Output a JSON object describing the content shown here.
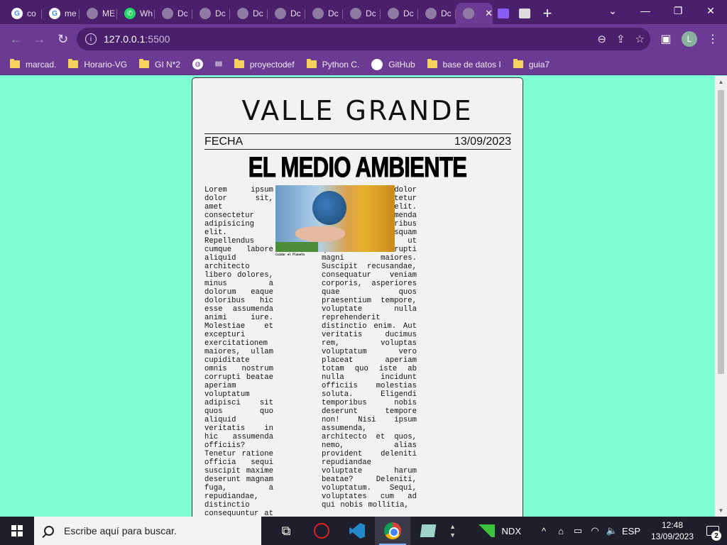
{
  "browser": {
    "tabs": [
      {
        "title": "co",
        "icon": "google-icon"
      },
      {
        "title": "me",
        "icon": "google-icon"
      },
      {
        "title": "ME",
        "icon": "globe-icon"
      },
      {
        "title": "Wh",
        "icon": "whatsapp-icon"
      },
      {
        "title": "Dc",
        "icon": "globe-icon"
      },
      {
        "title": "Dc",
        "icon": "globe-icon"
      },
      {
        "title": "Dc",
        "icon": "globe-icon"
      },
      {
        "title": "Dc",
        "icon": "globe-icon"
      },
      {
        "title": "Dc",
        "icon": "globe-icon"
      },
      {
        "title": "Dc",
        "icon": "globe-icon"
      },
      {
        "title": "Dc",
        "icon": "globe-icon"
      },
      {
        "title": "Dc",
        "icon": "globe-icon"
      }
    ],
    "active_tab": {
      "title": "",
      "close_glyph": "✕"
    },
    "new_tab_glyph": "+",
    "window_controls": {
      "tab_search": "⌄",
      "minimize": "—",
      "restore": "❐",
      "close": "✕"
    },
    "address": {
      "host": "127.0.0.1",
      "port": ":5500"
    },
    "profile_initial": "L",
    "bookmarks": [
      {
        "label": "marcad.",
        "icon": "folder-icon"
      },
      {
        "label": "Horario-VG",
        "icon": "folder-icon"
      },
      {
        "label": "GI N*2",
        "icon": "folder-icon"
      },
      {
        "label": "",
        "icon": "globe-icon"
      },
      {
        "label": "",
        "icon": "cisco-icon"
      },
      {
        "label": "proyectodef",
        "icon": "folder-icon"
      },
      {
        "label": "Python C.",
        "icon": "folder-icon"
      },
      {
        "label": "GitHub",
        "icon": "github-icon"
      },
      {
        "label": "base de datos I",
        "icon": "folder-icon"
      },
      {
        "label": "guia7",
        "icon": "folder-icon"
      }
    ]
  },
  "newspaper": {
    "masthead": "VALLE GRANDE",
    "date_label": "FECHA",
    "date_value": "13/09/2023",
    "headline": "EL MEDIO AMBIENTE",
    "photo_caption": "Cuidar el Planeta",
    "column1": "Lorem ipsum dolor sit, amet consectetur adipisicing elit. Repellendus cumque labore aliquid architecto libero dolores, minus a dolorum eaque doloribus hic esse assumenda animi iure. Molestiae et excepturi exercitationem maiores, ullam cupiditate omnis nostrum corrupti beatae aperiam voluptatum adipisci sit quos quo aliquid veritatis in hic assumenda officiis? Tenetur ratione officia sequi suscipit maxime deserunt magnam fuga, a repudiandae, distinctio consequuntur at eaque nam quo quod modi quia",
    "column2": "Lorem ipsum dolor sit amet consectetur adipisicing elit. Quos iusto assumenda omnis doloribus distinctio, quisquam numquam illum ut quibusdam corrupti magni maiores. Suscipit recusandae, consequatur veniam corporis, asperiores quae quos praesentium tempore, voluptate nulla reprehenderit distinctio enim. Aut veritatis ducimus rem, voluptas voluptatum vero placeat aperiam totam quo iste ab nulla incidunt officiis molestias soluta. Eligendi temporibus nobis deserunt tempore non! Nisi ipsum assumenda, architecto et quos, nemo, alias provident deleniti repudiandae voluptate harum beatae? Deleniti, voluptatum. Sequi, voluptates cum ad qui nobis mollitia,"
  },
  "taskbar": {
    "search_placeholder": "Escribe aquí para buscar.",
    "ndx_label": "NDX",
    "language": "ESP",
    "time": "12:48",
    "date": "13/09/2023",
    "notifications": "2"
  }
}
